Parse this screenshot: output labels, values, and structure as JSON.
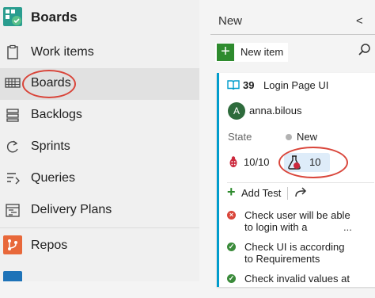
{
  "nav": {
    "header_title": "Boards",
    "items": [
      {
        "label": "Work items",
        "icon": "work-items-icon"
      },
      {
        "label": "Boards",
        "icon": "boards-grid-icon",
        "active": true
      },
      {
        "label": "Backlogs",
        "icon": "backlogs-icon"
      },
      {
        "label": "Sprints",
        "icon": "sprints-icon"
      },
      {
        "label": "Queries",
        "icon": "queries-icon"
      },
      {
        "label": "Delivery Plans",
        "icon": "delivery-plans-icon"
      }
    ],
    "repos_label": "Repos"
  },
  "board": {
    "column_title": "New",
    "new_item_label": "New item",
    "card": {
      "id": "39",
      "title": "Login Page UI",
      "assignee": "anna.bilous",
      "avatar_initial": "A",
      "state_label": "State",
      "state_value": "New",
      "bugs_count": "10/10",
      "test_count": "10",
      "add_test_label": "Add Test",
      "tests": [
        {
          "text": "Check user will be able to login with a",
          "status": "fail",
          "more": "..."
        },
        {
          "text": "Check UI is according to Requirements",
          "status": "pass"
        },
        {
          "text": "Check invalid values at",
          "status": "pass"
        }
      ]
    }
  },
  "colors": {
    "accent": "#009ccc",
    "green": "#2e8b2e",
    "annotation": "#d9453a"
  }
}
